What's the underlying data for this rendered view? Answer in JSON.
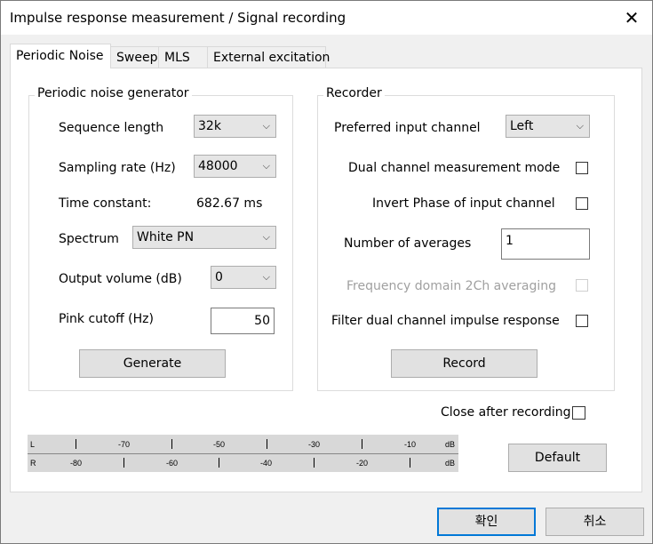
{
  "window": {
    "title": "Impulse response measurement / Signal recording",
    "close_glyph": "✕"
  },
  "tabs": [
    {
      "label": "Periodic Noise",
      "active": true
    },
    {
      "label": "Sweep"
    },
    {
      "label": "MLS"
    },
    {
      "label": "External excitation"
    }
  ],
  "generator": {
    "title": "Periodic noise generator",
    "sequence_length_label": "Sequence length",
    "sequence_length_value": "32k",
    "sampling_rate_label": "Sampling rate (Hz)",
    "sampling_rate_value": "48000",
    "time_constant_label": "Time constant:",
    "time_constant_value": "682.67 ms",
    "spectrum_label": "Spectrum",
    "spectrum_value": "White PN",
    "output_volume_label": "Output volume (dB)",
    "output_volume_value": "0",
    "pink_cutoff_label": "Pink cutoff (Hz)",
    "pink_cutoff_value": "50",
    "generate_label": "Generate"
  },
  "recorder": {
    "title": "Recorder",
    "preferred_input_label": "Preferred input channel",
    "preferred_input_value": "Left",
    "dual_channel_label": "Dual channel measurement mode",
    "invert_phase_label": "Invert Phase of input channel",
    "averages_label": "Number of averages",
    "averages_value": "1",
    "freq_domain_label": "Frequency domain 2Ch averaging",
    "filter_dual_label": "Filter dual channel impulse response",
    "record_label": "Record"
  },
  "close_after_label": "Close after recording",
  "meter": {
    "top": {
      "channel": "L",
      "marks": [
        "-70",
        "-50",
        "-30",
        "-10"
      ],
      "unit": "dB"
    },
    "bottom": {
      "channel": "R",
      "marks": [
        "-80",
        "-60",
        "-40",
        "-20"
      ],
      "unit": "dB"
    }
  },
  "default_label": "Default",
  "ok_label": "확인",
  "cancel_label": "취소",
  "icons": {
    "dropdown": "chevron-down-icon",
    "close": "close-icon"
  }
}
